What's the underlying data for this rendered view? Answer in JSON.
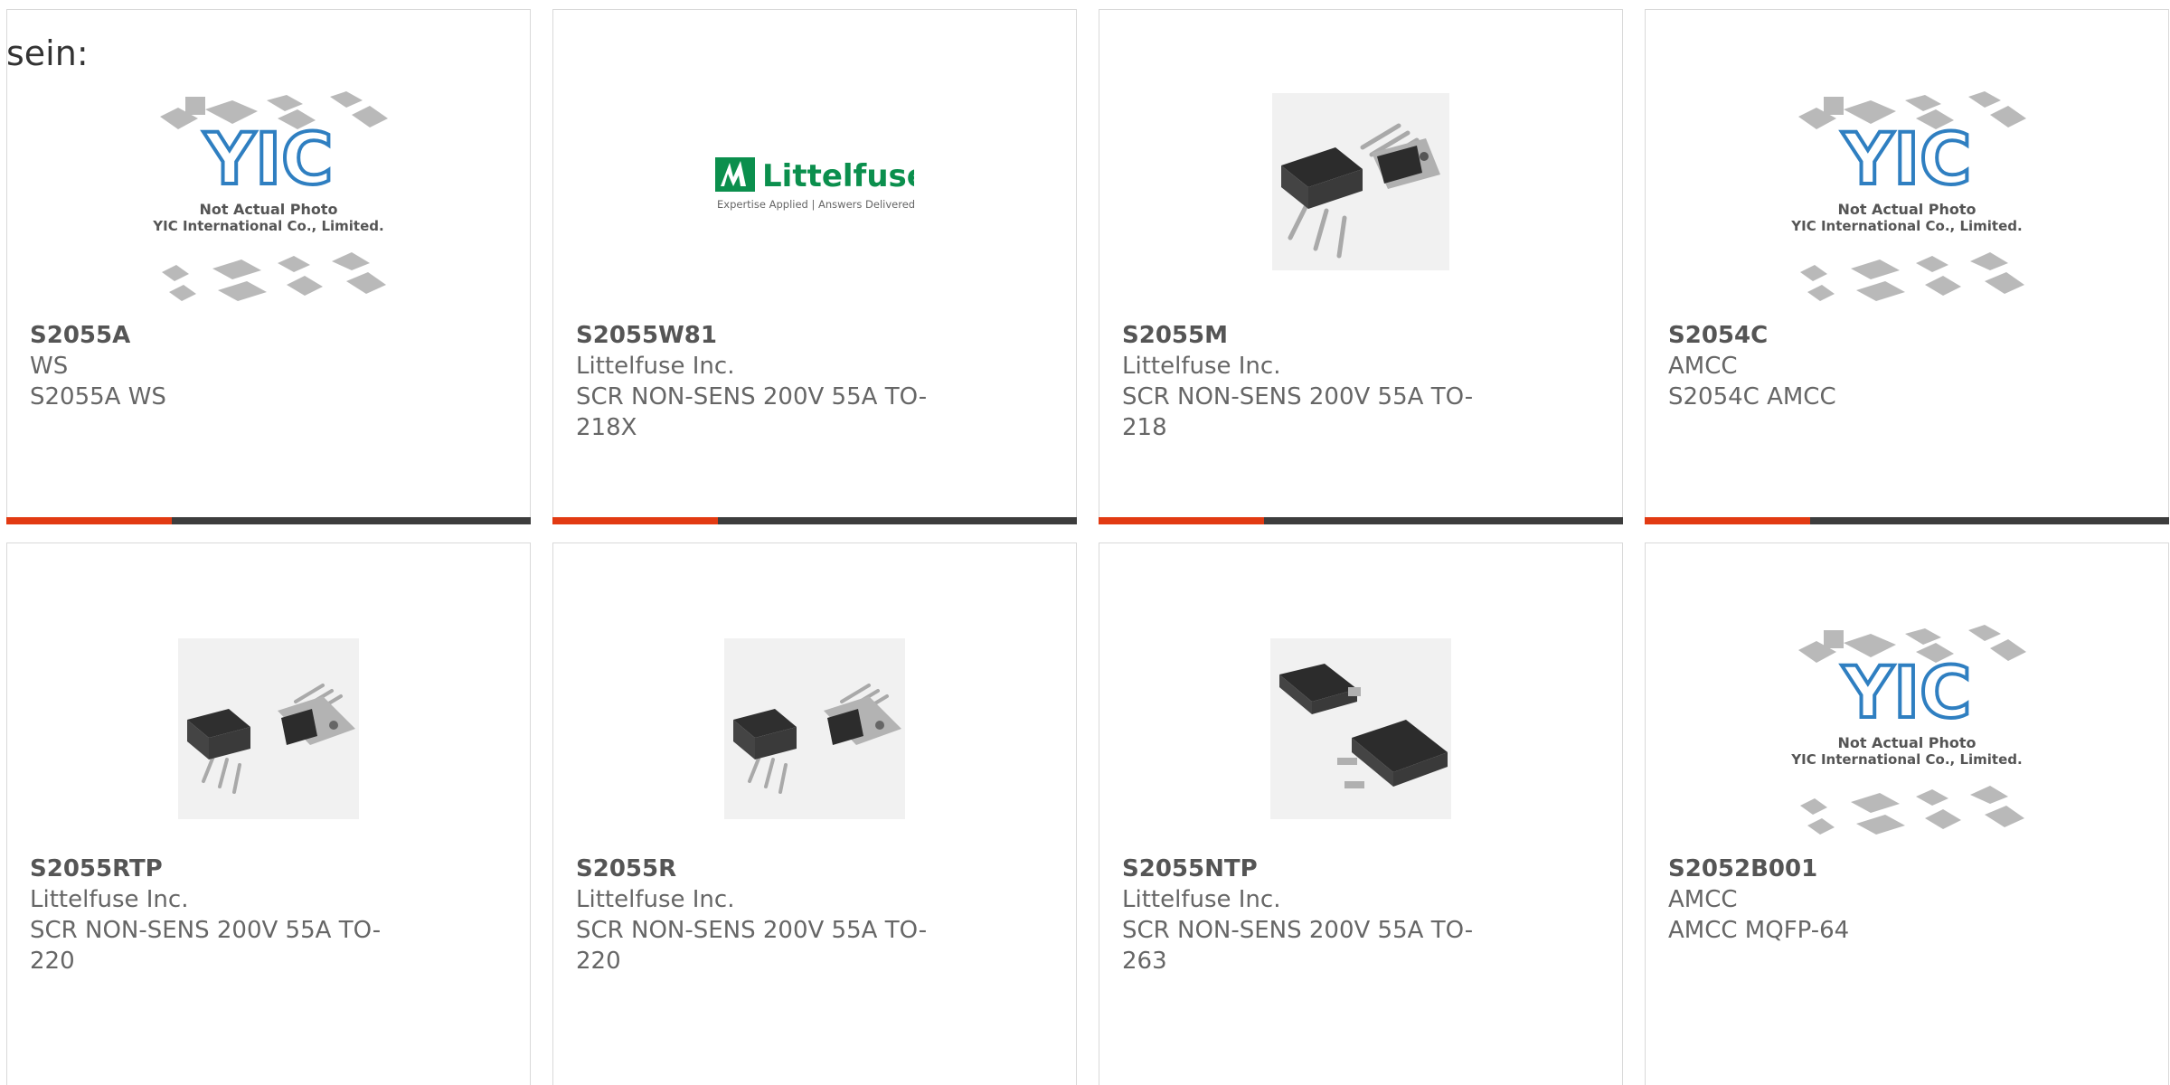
{
  "intro_text": "sein:",
  "colors": {
    "accent": "#e23a12",
    "bar": "#3d3d3d",
    "border": "#d9d9d9",
    "part_number": "#555555",
    "text": "#666666"
  },
  "products": [
    {
      "part_number": "S2055A",
      "manufacturer": "WS",
      "description": "S2055A WS",
      "image": "yic-placeholder",
      "placeholder_caption_1": "Not Actual Photo",
      "placeholder_caption_2": "YIC International Co., Limited."
    },
    {
      "part_number": "S2055W81",
      "manufacturer": "Littelfuse Inc.",
      "description": "SCR NON-SENS 200V 55A TO-218X",
      "image": "littelfuse-logo",
      "logo_name": "Littelfuse",
      "logo_tagline": "Expertise Applied | Answers Delivered"
    },
    {
      "part_number": "S2055M",
      "manufacturer": "Littelfuse Inc.",
      "description": "SCR NON-SENS 200V 55A TO-218",
      "image": "to-218-package"
    },
    {
      "part_number": "S2054C",
      "manufacturer": "AMCC",
      "description": "S2054C AMCC",
      "image": "yic-placeholder",
      "placeholder_caption_1": "Not Actual Photo",
      "placeholder_caption_2": "YIC International Co., Limited."
    },
    {
      "part_number": "S2055RTP",
      "manufacturer": "Littelfuse Inc.",
      "description": "SCR NON-SENS 200V 55A TO-220",
      "image": "to-220-package"
    },
    {
      "part_number": "S2055R",
      "manufacturer": "Littelfuse Inc.",
      "description": "SCR NON-SENS 200V 55A TO-220",
      "image": "to-220-package"
    },
    {
      "part_number": "S2055NTP",
      "manufacturer": "Littelfuse Inc.",
      "description": "SCR NON-SENS 200V 55A TO-263",
      "image": "to-263-package"
    },
    {
      "part_number": "S2052B001",
      "manufacturer": "AMCC",
      "description": "AMCC MQFP-64",
      "image": "yic-placeholder",
      "placeholder_caption_1": "Not Actual Photo",
      "placeholder_caption_2": "YIC International Co., Limited."
    }
  ]
}
